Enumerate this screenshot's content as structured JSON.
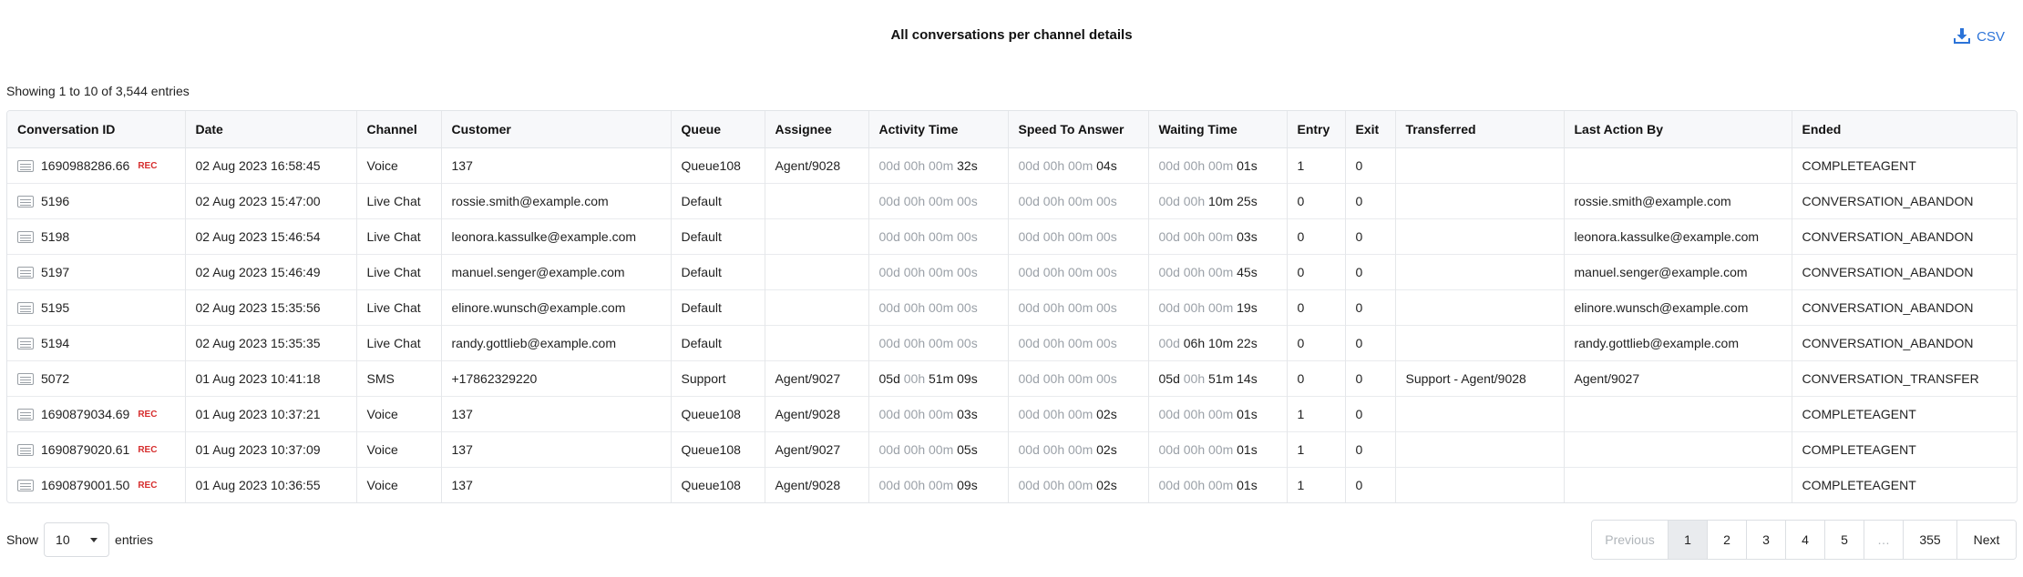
{
  "header": {
    "title": "All conversations per channel details",
    "csv_label": "CSV"
  },
  "info_text": "Showing 1 to 10 of 3,544 entries",
  "columns": [
    "Conversation ID",
    "Date",
    "Channel",
    "Customer",
    "Queue",
    "Assignee",
    "Activity Time",
    "Speed To Answer",
    "Waiting Time",
    "Entry",
    "Exit",
    "Transferred",
    "Last Action By",
    "Ended"
  ],
  "rows": [
    {
      "id": "1690988286.66",
      "rec": "REC",
      "date": "02 Aug 2023 16:58:45",
      "channel": "Voice",
      "customer": "137",
      "queue": "Queue108",
      "assignee": "Agent/9028",
      "activity": {
        "z": "00d 00h 00m ",
        "v": "32s"
      },
      "speed": {
        "z": "00d 00h 00m ",
        "v": "04s"
      },
      "waiting": {
        "z": "00d 00h 00m ",
        "v": "01s"
      },
      "entry": "1",
      "exit": "0",
      "transferred": "",
      "last_action": "",
      "ended": "COMPLETEAGENT"
    },
    {
      "id": "5196",
      "rec": "",
      "date": "02 Aug 2023 15:47:00",
      "channel": "Live Chat",
      "customer": "rossie.smith@example.com",
      "queue": "Default",
      "assignee": "",
      "activity": {
        "z": "00d 00h 00m 00s",
        "v": ""
      },
      "speed": {
        "z": "00d 00h 00m 00s",
        "v": ""
      },
      "waiting": {
        "z": "00d 00h ",
        "v": "10m 25s"
      },
      "entry": "0",
      "exit": "0",
      "transferred": "",
      "last_action": "rossie.smith@example.com",
      "ended": "CONVERSATION_ABANDON"
    },
    {
      "id": "5198",
      "rec": "",
      "date": "02 Aug 2023 15:46:54",
      "channel": "Live Chat",
      "customer": "leonora.kassulke@example.com",
      "queue": "Default",
      "assignee": "",
      "activity": {
        "z": "00d 00h 00m 00s",
        "v": ""
      },
      "speed": {
        "z": "00d 00h 00m 00s",
        "v": ""
      },
      "waiting": {
        "z": "00d 00h 00m ",
        "v": "03s"
      },
      "entry": "0",
      "exit": "0",
      "transferred": "",
      "last_action": "leonora.kassulke@example.com",
      "ended": "CONVERSATION_ABANDON"
    },
    {
      "id": "5197",
      "rec": "",
      "date": "02 Aug 2023 15:46:49",
      "channel": "Live Chat",
      "customer": "manuel.senger@example.com",
      "queue": "Default",
      "assignee": "",
      "activity": {
        "z": "00d 00h 00m 00s",
        "v": ""
      },
      "speed": {
        "z": "00d 00h 00m 00s",
        "v": ""
      },
      "waiting": {
        "z": "00d 00h 00m ",
        "v": "45s"
      },
      "entry": "0",
      "exit": "0",
      "transferred": "",
      "last_action": "manuel.senger@example.com",
      "ended": "CONVERSATION_ABANDON"
    },
    {
      "id": "5195",
      "rec": "",
      "date": "02 Aug 2023 15:35:56",
      "channel": "Live Chat",
      "customer": "elinore.wunsch@example.com",
      "queue": "Default",
      "assignee": "",
      "activity": {
        "z": "00d 00h 00m 00s",
        "v": ""
      },
      "speed": {
        "z": "00d 00h 00m 00s",
        "v": ""
      },
      "waiting": {
        "z": "00d 00h 00m ",
        "v": "19s"
      },
      "entry": "0",
      "exit": "0",
      "transferred": "",
      "last_action": "elinore.wunsch@example.com",
      "ended": "CONVERSATION_ABANDON"
    },
    {
      "id": "5194",
      "rec": "",
      "date": "02 Aug 2023 15:35:35",
      "channel": "Live Chat",
      "customer": "randy.gottlieb@example.com",
      "queue": "Default",
      "assignee": "",
      "activity": {
        "z": "00d 00h 00m 00s",
        "v": ""
      },
      "speed": {
        "z": "00d 00h 00m 00s",
        "v": ""
      },
      "waiting": {
        "z": "00d ",
        "v": "06h 10m 22s"
      },
      "entry": "0",
      "exit": "0",
      "transferred": "",
      "last_action": "randy.gottlieb@example.com",
      "ended": "CONVERSATION_ABANDON"
    },
    {
      "id": "5072",
      "rec": "",
      "date": "01 Aug 2023 10:41:18",
      "channel": "SMS",
      "customer": "+17862329220",
      "queue": "Support",
      "assignee": "Agent/9027",
      "activity": {
        "z": "",
        "v": "05d ",
        "z2": "00h ",
        "v2": "51m 09s"
      },
      "speed": {
        "z": "00d 00h 00m 00s",
        "v": ""
      },
      "waiting": {
        "z": "",
        "v": "05d ",
        "z2": "00h ",
        "v2": "51m 14s"
      },
      "entry": "0",
      "exit": "0",
      "transferred": "Support - Agent/9028",
      "last_action": "Agent/9027",
      "ended": "CONVERSATION_TRANSFER"
    },
    {
      "id": "1690879034.69",
      "rec": "REC",
      "date": "01 Aug 2023 10:37:21",
      "channel": "Voice",
      "customer": "137",
      "queue": "Queue108",
      "assignee": "Agent/9028",
      "activity": {
        "z": "00d 00h 00m ",
        "v": "03s"
      },
      "speed": {
        "z": "00d 00h 00m ",
        "v": "02s"
      },
      "waiting": {
        "z": "00d 00h 00m ",
        "v": "01s"
      },
      "entry": "1",
      "exit": "0",
      "transferred": "",
      "last_action": "",
      "ended": "COMPLETEAGENT"
    },
    {
      "id": "1690879020.61",
      "rec": "REC",
      "date": "01 Aug 2023 10:37:09",
      "channel": "Voice",
      "customer": "137",
      "queue": "Queue108",
      "assignee": "Agent/9027",
      "activity": {
        "z": "00d 00h 00m ",
        "v": "05s"
      },
      "speed": {
        "z": "00d 00h 00m ",
        "v": "02s"
      },
      "waiting": {
        "z": "00d 00h 00m ",
        "v": "01s"
      },
      "entry": "1",
      "exit": "0",
      "transferred": "",
      "last_action": "",
      "ended": "COMPLETEAGENT"
    },
    {
      "id": "1690879001.50",
      "rec": "REC",
      "date": "01 Aug 2023 10:36:55",
      "channel": "Voice",
      "customer": "137",
      "queue": "Queue108",
      "assignee": "Agent/9028",
      "activity": {
        "z": "00d 00h 00m ",
        "v": "09s"
      },
      "speed": {
        "z": "00d 00h 00m ",
        "v": "02s"
      },
      "waiting": {
        "z": "00d 00h 00m ",
        "v": "01s"
      },
      "entry": "1",
      "exit": "0",
      "transferred": "",
      "last_action": "",
      "ended": "COMPLETEAGENT"
    }
  ],
  "footer": {
    "show_label": "Show",
    "page_size": "10",
    "entries_label": "entries",
    "pagination": [
      "Previous",
      "1",
      "2",
      "3",
      "4",
      "5",
      "…",
      "355",
      "Next"
    ]
  },
  "colors": {
    "accent": "#2b73d8",
    "rec": "#d62d2d",
    "muted": "#9ba1a8"
  }
}
